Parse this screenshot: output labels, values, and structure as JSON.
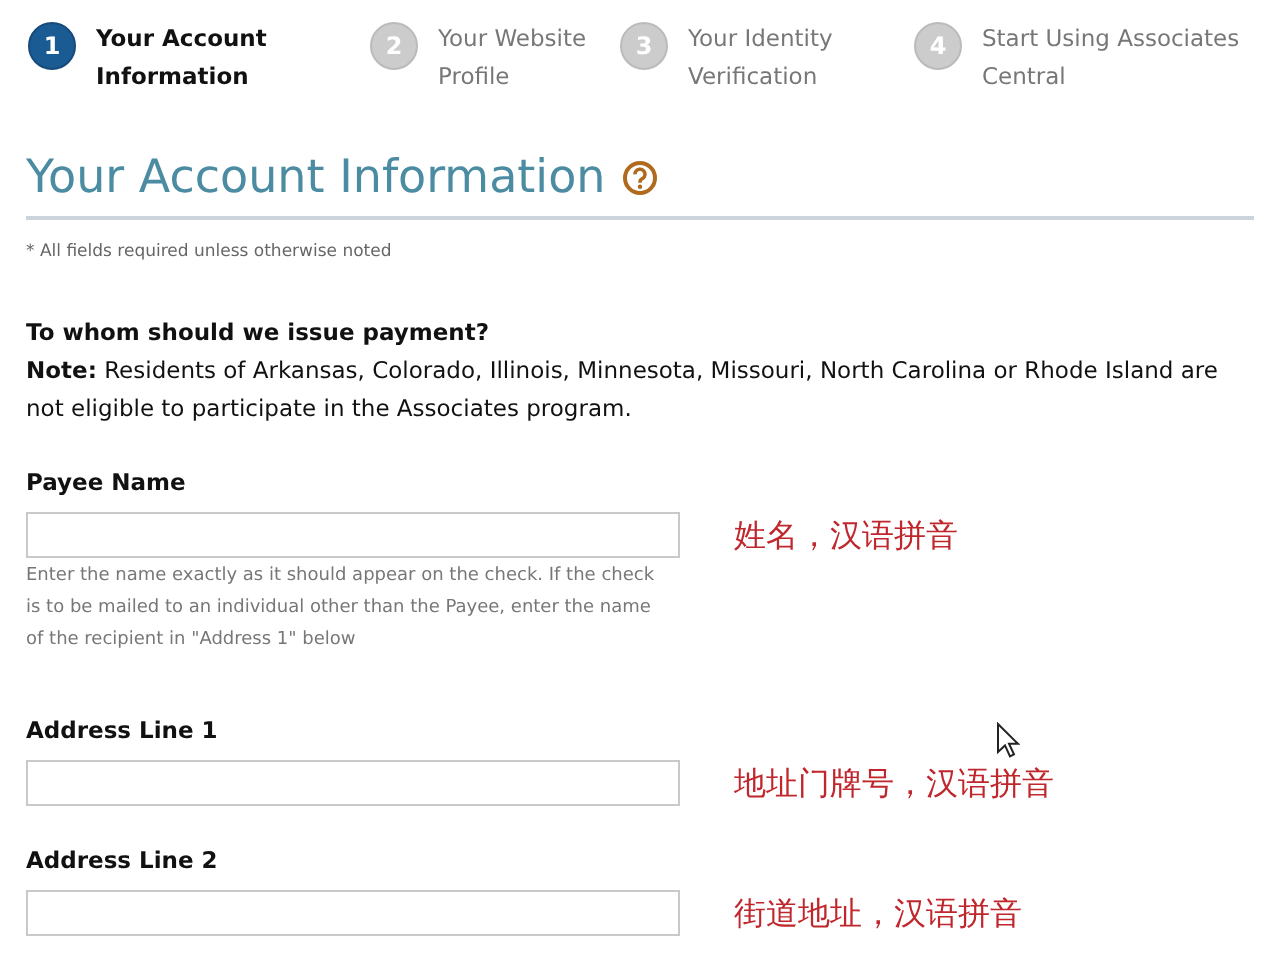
{
  "steps": [
    {
      "number": "1",
      "label": "Your Account Information",
      "selected": true
    },
    {
      "number": "2",
      "label": "Your Website Profile",
      "selected": false
    },
    {
      "number": "3",
      "label": "Your Identity Verification",
      "selected": false
    },
    {
      "number": "4",
      "label": "Start Using Associates Central",
      "selected": false
    }
  ],
  "title": "Your Account Information",
  "required_note": "* All fields required unless otherwise noted",
  "question": "To whom should we issue payment?",
  "note": "**Note:** Residents of Arkansas, Colorado, Illinois, Minnesota, Missouri, North Carolina or Rhode Island are not eligible to participate in the Associates program.",
  "fields": [
    {
      "label": "Payee Name",
      "hint": "Enter the name exactly as it should appear on the check. If the check is to be mailed to an individual other than the Payee, enter the name of the recipient in \"Address 1\" below",
      "annotation": "姓名，汉语拼音"
    },
    {
      "label": "Address Line 1",
      "annotation": "地址门牌号，汉语拼音"
    },
    {
      "label": "Address Line 2",
      "annotation": "街道地址，汉语拼音"
    }
  ]
}
